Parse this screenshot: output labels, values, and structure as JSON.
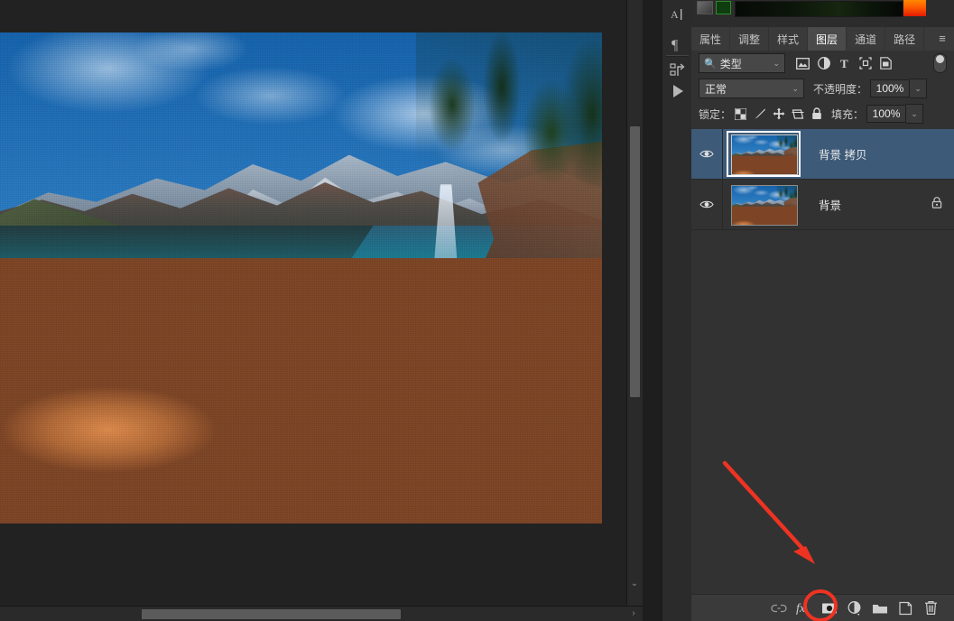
{
  "app": {
    "name": "Adobe Photoshop",
    "accent_selected_layer": "#3d5a78",
    "annotation_color": "#ee3322",
    "panel_bg": "#323232"
  },
  "canvas": {
    "name": "document-canvas",
    "image_description": "Mountain lake landscape with snowy peaks, blue sky with clouds, evergreen trees and orange foreground rocks in clear water",
    "vscroll_position": "140",
    "hscroll_position": "157",
    "scroll_down_glyph": "⌄",
    "scroll_right_glyph": "›"
  },
  "icon_rail": {
    "items": [
      {
        "name": "character-panel-icon",
        "glyph": "A|"
      },
      {
        "name": "paragraph-panel-icon",
        "glyph": "¶"
      },
      {
        "name": "history-panel-icon",
        "glyph": "↱"
      },
      {
        "name": "actions-play-icon",
        "glyph": "▶"
      }
    ]
  },
  "top_strip": {
    "gradient_bar_label": "gradient-preview-bar",
    "swatch_label": "foreground-gradient-swatch",
    "gradient_colors": [
      "#ff8a00",
      "#ff5a00",
      "#e01b00"
    ],
    "bar_colors": [
      "#060a06",
      "#16260f",
      "#050805"
    ]
  },
  "panel": {
    "tabs": [
      {
        "label": "属性",
        "name": "tab-properties",
        "active": false
      },
      {
        "label": "调整",
        "name": "tab-adjustments",
        "active": false
      },
      {
        "label": "样式",
        "name": "tab-styles",
        "active": false
      },
      {
        "label": "图层",
        "name": "tab-layers",
        "active": true
      },
      {
        "label": "通道",
        "name": "tab-channels",
        "active": false
      },
      {
        "label": "路径",
        "name": "tab-paths",
        "active": false
      }
    ],
    "menu_glyph": "≡"
  },
  "filter_row": {
    "search_icon": "search-icon",
    "filter_type_value": "类型",
    "caret": "⌄",
    "icons": [
      {
        "name": "filter-pixel-layers-icon",
        "glyph": "▤"
      },
      {
        "name": "filter-adjustment-layers-icon",
        "glyph": "◐"
      },
      {
        "name": "filter-type-layers-icon",
        "glyph": "T"
      },
      {
        "name": "filter-shape-layers-icon",
        "glyph": "⬚"
      },
      {
        "name": "filter-smart-object-icon",
        "glyph": "▣"
      }
    ],
    "toggle_name": "filter-enable-toggle"
  },
  "blend_row": {
    "blend_mode": "正常",
    "opacity_label": "不透明度：",
    "opacity_value": "100%",
    "caret": "⌄"
  },
  "lock_row": {
    "lock_label": "锁定：",
    "fill_label": "填充：",
    "fill_value": "100%",
    "caret": "⌄",
    "lock_icons": [
      {
        "name": "lock-transparent-pixels-icon",
        "glyph": "▩"
      },
      {
        "name": "lock-image-pixels-icon",
        "glyph": "✎"
      },
      {
        "name": "lock-position-icon",
        "glyph": "✛"
      },
      {
        "name": "lock-artboard-nesting-icon",
        "glyph": "⌗"
      },
      {
        "name": "lock-all-icon",
        "glyph": "🔒"
      }
    ]
  },
  "layers": [
    {
      "name": "背景 拷贝",
      "selected": true,
      "visible": true,
      "locked": false,
      "row_name": "layer-row-background-copy"
    },
    {
      "name": "背景",
      "selected": false,
      "visible": true,
      "locked": true,
      "row_name": "layer-row-background"
    }
  ],
  "bottom_toolbar": {
    "buttons": [
      {
        "name": "link-layers-button",
        "glyph": "link",
        "highlighted": false
      },
      {
        "name": "layer-style-fx-button",
        "glyph": "fx",
        "highlighted": false
      },
      {
        "name": "add-layer-mask-button",
        "glyph": "mask",
        "highlighted": true
      },
      {
        "name": "new-adjustment-layer-button",
        "glyph": "halfcircle",
        "highlighted": false
      },
      {
        "name": "new-group-button",
        "glyph": "folder",
        "highlighted": false
      },
      {
        "name": "new-layer-button",
        "glyph": "newlayer",
        "highlighted": false
      },
      {
        "name": "delete-layer-button",
        "glyph": "trash",
        "highlighted": false
      }
    ]
  },
  "annotation": {
    "arrow_name": "red-pointer-arrow",
    "circle_name": "red-highlight-circle",
    "target": "add-layer-mask-button",
    "color": "#ee3322"
  }
}
